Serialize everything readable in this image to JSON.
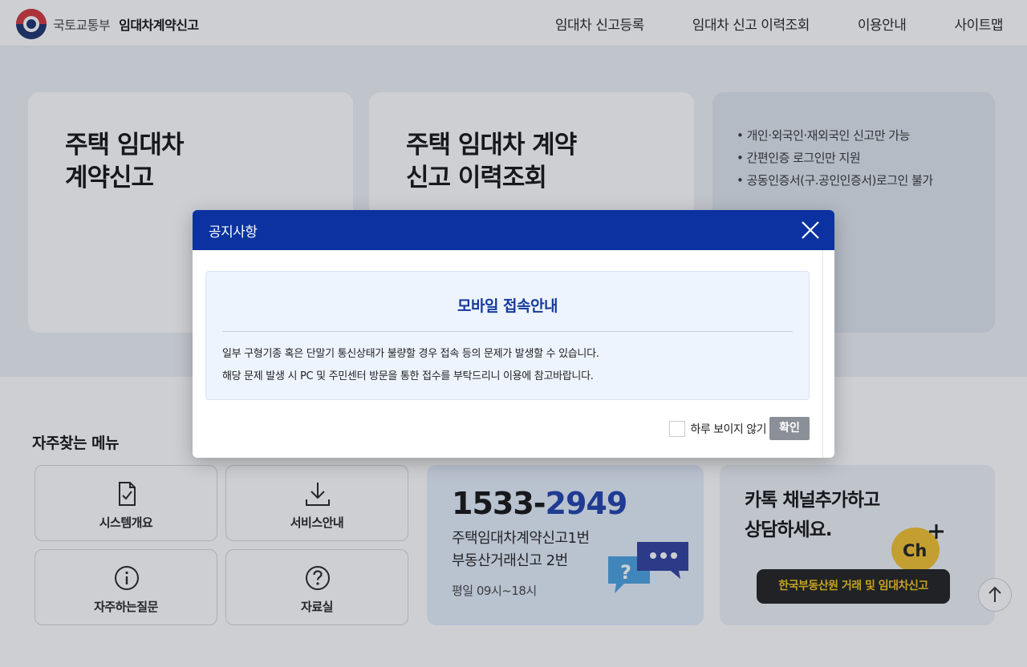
{
  "header": {
    "ministry": "국토교통부",
    "service_name": "임대차계약신고",
    "nav": [
      "임대차 신고등록",
      "임대차 신고 이력조회",
      "이용안내",
      "사이트맵"
    ]
  },
  "cards": {
    "report_title_line1": "주택 임대차",
    "report_title_line2": "계약신고",
    "history_title_line1": "주택 임대차 계약",
    "history_title_line2": "신고 이력조회",
    "notes": [
      "개인·외국인·재외국인 신고만 가능",
      "간편인증 로그인만 지원",
      "공동인증서(구.공인인증서)로그인 불가"
    ]
  },
  "quick_menu": {
    "title": "자주찾는 메뉴",
    "items": [
      {
        "label": "시스템개요",
        "icon": "document-check-icon"
      },
      {
        "label": "서비스안내",
        "icon": "download-icon"
      },
      {
        "label": "자주하는질문",
        "icon": "info-icon"
      },
      {
        "label": "자료실",
        "icon": "question-icon"
      }
    ]
  },
  "contact": {
    "phone_prefix": "1533-",
    "phone_suffix": "2949",
    "line1": "주택임대차계약신고1번",
    "line2": "부동산거래신고 2번",
    "hours": "평일 09시~18시"
  },
  "kakao": {
    "title_line1": "카톡 채널추가하고",
    "title_line2": "상담하세요.",
    "ch_label": "Ch",
    "button": "한국부동산원 거래 및 임대차신고"
  },
  "modal": {
    "title": "공지사항",
    "notice_title": "모바일 접속안내",
    "line1": "일부 구형기종 혹은 단말기 통신상태가 불량할 경우 접속 등의 문제가 발생할 수 있습니다.",
    "line2": "해당 문제 발생 시 PC 및 주민센터 방문을 통한 접수를 부탁드리니 이용에 참고바랍니다.",
    "checkbox_label": "하루 보이지 않기",
    "ok_label": "확인"
  },
  "colors": {
    "modal_header": "#0b32a0",
    "notice_title": "#163a9c",
    "phone_accent": "#1d3fae",
    "kakao_yellow": "#f5c518"
  }
}
